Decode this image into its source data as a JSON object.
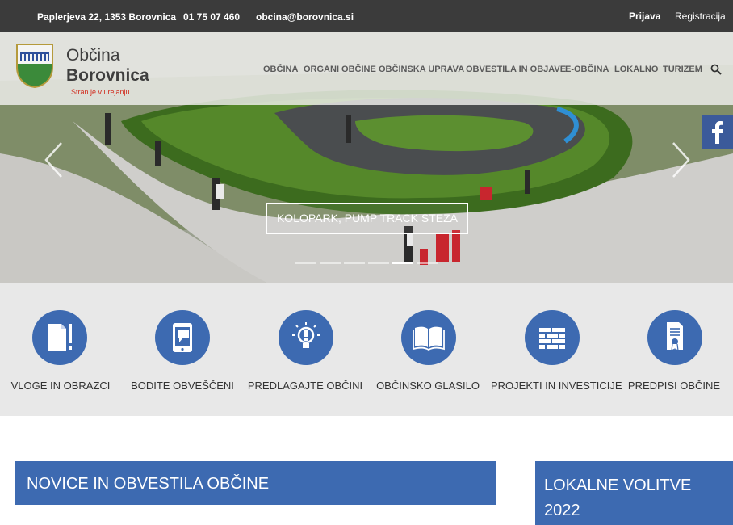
{
  "topbar": {
    "address": "Paplerjeva 22, 1353 Borovnica",
    "phone": "01 75 07 460",
    "email": "obcina@borovnica.si",
    "login": "Prijava",
    "register": "Registracija"
  },
  "logo": {
    "line1": "Občina",
    "line2": "Borovnica",
    "subtitle": "Stran je v urejanju"
  },
  "nav": {
    "items": [
      "OBČINA",
      "ORGANI OBČINE",
      "OBČINSKA UPRAVA",
      "OBVESTILA IN OBJAVE",
      "E-OBČINA",
      "LOKALNO",
      "TURIZEM"
    ]
  },
  "hero": {
    "caption": "KOLOPARK, PUMP TRACK STEZA",
    "slide_count": 6,
    "active_slide": 5
  },
  "quick_links": [
    {
      "label": "VLOGE IN OBRAZCI",
      "icon": "document-icon"
    },
    {
      "label": "BODITE OBVEŠČENI",
      "icon": "phone-message-icon"
    },
    {
      "label": "PREDLAGAJTE OBČINI",
      "icon": "lightbulb-icon"
    },
    {
      "label": "OBČINSKO GLASILO",
      "icon": "book-icon"
    },
    {
      "label": "PROJEKTI IN INVESTICIJE",
      "icon": "brick-wall-icon"
    },
    {
      "label": "PREDPISI OBČINE",
      "icon": "certificate-icon"
    }
  ],
  "sections": {
    "news_title": "NOVICE IN OBVESTILA OBČINE",
    "side_title": "LOKALNE VOLITVE 2022"
  },
  "colors": {
    "primary_blue": "#3d6ab1",
    "topbar": "#3b3b3b",
    "subtitle_red": "#d12a1c",
    "facebook": "#3b5a9a"
  }
}
